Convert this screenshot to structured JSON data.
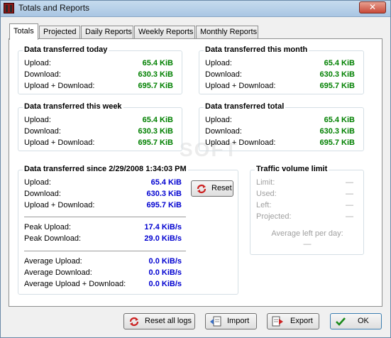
{
  "window": {
    "title": "Totals and Reports",
    "close_label": "✕"
  },
  "tabs": [
    {
      "label": "Totals",
      "active": true
    },
    {
      "label": "Projected"
    },
    {
      "label": "Daily Reports"
    },
    {
      "label": "Weekly Reports"
    },
    {
      "label": "Monthly Reports"
    }
  ],
  "labels": {
    "upload": "Upload:",
    "download": "Download:",
    "both": "Upload + Download:"
  },
  "today": {
    "title": "Data transferred today",
    "upload": "65.4 KiB",
    "download": "630.3 KiB",
    "both": "695.7 KiB"
  },
  "month": {
    "title": "Data transferred this month",
    "upload": "65.4 KiB",
    "download": "630.3 KiB",
    "both": "695.7 KiB"
  },
  "week": {
    "title": "Data transferred this week",
    "upload": "65.4 KiB",
    "download": "630.3 KiB",
    "both": "695.7 KiB"
  },
  "total": {
    "title": "Data transferred total",
    "upload": "65.4 KiB",
    "download": "630.3 KiB",
    "both": "695.7 KiB"
  },
  "since": {
    "title": "Data transferred since 2/29/2008 1:34:03 PM",
    "upload": "65.4 KiB",
    "download": "630.3 KiB",
    "both": "695.7 KiB",
    "peak_upload_label": "Peak Upload:",
    "peak_upload": "17.4 KiB/s",
    "peak_download_label": "Peak Download:",
    "peak_download": "29.0 KiB/s",
    "avg_upload_label": "Average Upload:",
    "avg_upload": "0.0 KiB/s",
    "avg_download_label": "Average Download:",
    "avg_download": "0.0 KiB/s",
    "avg_both_label": "Average Upload + Download:",
    "avg_both": "0.0 KiB/s",
    "reset_label": "Reset"
  },
  "limit": {
    "title": "Traffic volume limit",
    "limit_label": "Limit:",
    "used_label": "Used:",
    "left_label": "Left:",
    "projected_label": "Projected:",
    "limit": "—",
    "used": "—",
    "left": "—",
    "projected": "—",
    "avg_left_label": "Average left per day:",
    "avg_left": "—"
  },
  "buttons": {
    "reset_all": "Reset all logs",
    "import": "Import",
    "export": "Export",
    "ok": "OK"
  },
  "colors": {
    "green_value": "#008000",
    "blue_value": "#0000d0",
    "reset_red": "#cc2222"
  }
}
